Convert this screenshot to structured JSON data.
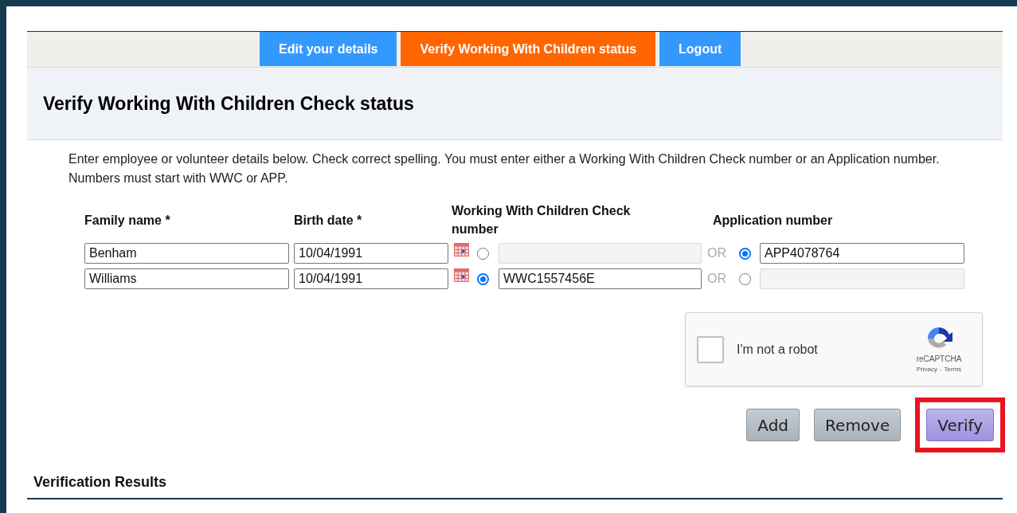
{
  "nav_tabs": [
    {
      "label": "Edit your details",
      "selected": false
    },
    {
      "label": "Verify Working With Children status",
      "selected": true
    },
    {
      "label": "Logout",
      "selected": false
    }
  ],
  "heading": "Verify Working With Children Check status",
  "instructions": "Enter employee or volunteer details below. Check correct spelling. You must enter either a Working With Children Check number or an Application number. Numbers must start with WWC or APP.",
  "columns": [
    "Family name *",
    "Birth date *",
    "Working With Children Check number",
    "Application number"
  ],
  "rows": [
    {
      "family_name": "Benham",
      "birth_date": "10/04/1991",
      "wwc_selected": false,
      "wwc_number": "",
      "separator": "OR",
      "app_selected": true,
      "app_number": "APP4078764"
    },
    {
      "family_name": "Williams",
      "birth_date": "10/04/1991",
      "wwc_selected": true,
      "wwc_number": "WWC1557456E",
      "separator": "OR",
      "app_selected": false,
      "app_number": ""
    }
  ],
  "captcha": {
    "label": "I'm not a robot",
    "checked": false,
    "brand": "reCAPTCHA",
    "privacy": "Privacy",
    "dash": "-",
    "terms": "Terms"
  },
  "buttons": [
    {
      "label": "Add",
      "kind": "grey",
      "highlighted": false
    },
    {
      "label": "Remove",
      "kind": "grey",
      "highlighted": false
    },
    {
      "label": "Verify",
      "kind": "purple",
      "highlighted": true
    }
  ],
  "results_heading": "Verification Results"
}
